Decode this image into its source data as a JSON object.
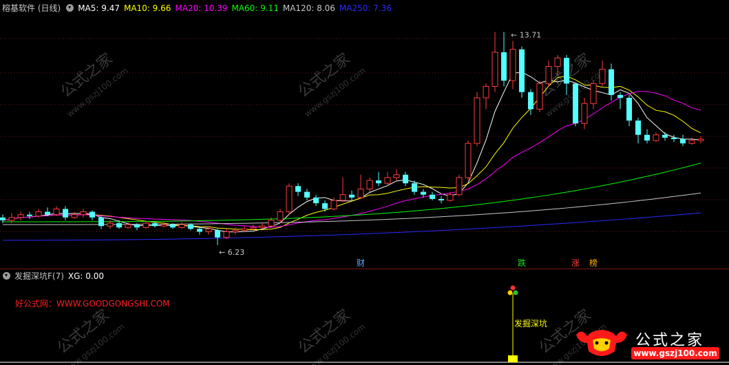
{
  "header": {
    "title": "榕基软件 (日线)",
    "ma": [
      {
        "label": "MA5: 9.47",
        "color": "#ffffff"
      },
      {
        "label": "MA10: 9.66",
        "color": "#ffff00"
      },
      {
        "label": "MA20: 10.39",
        "color": "#ff00ff"
      },
      {
        "label": "MA60: 9.11",
        "color": "#00ff00"
      },
      {
        "label": "MA120: 8.06",
        "color": "#c8c8c8"
      },
      {
        "label": "MA250: 7.36",
        "color": "#0000ff"
      }
    ]
  },
  "indicator": {
    "title": "发掘深坑F(7)",
    "xg": "XG: 0.00",
    "site": "好公式网：WWW.GOODGONGSHI.COM"
  },
  "watermark": {
    "brand": "公式之家",
    "url": "www.gszj100.com",
    "diag_text": "公式之家",
    "diag_url": "www.gszj100.com"
  },
  "chart_data": [
    {
      "type": "candlestick",
      "ylim": [
        5.6,
        14.3
      ],
      "grid": true,
      "annotations": [
        {
          "text": "13.71",
          "kind": "high",
          "bar": 56
        },
        {
          "text": "6.23",
          "kind": "low",
          "bar": 24
        }
      ],
      "event_markers": [
        {
          "text": "财",
          "color": "#5fa8ff",
          "bar": 40
        },
        {
          "text": "跌",
          "color": "#22dd22",
          "bar": 58
        },
        {
          "text": "涨",
          "color": "#ff4040",
          "bar": 64
        },
        {
          "text": "榜",
          "color": "#ffb000",
          "bar": 66
        }
      ],
      "candles": [
        [
          7.2,
          7.1,
          7.3,
          7.0
        ],
        [
          7.1,
          7.2,
          7.35,
          7.0
        ],
        [
          7.2,
          7.3,
          7.4,
          7.1
        ],
        [
          7.3,
          7.25,
          7.4,
          7.15
        ],
        [
          7.25,
          7.4,
          7.5,
          7.2
        ],
        [
          7.4,
          7.3,
          7.55,
          7.25
        ],
        [
          7.3,
          7.5,
          7.6,
          7.25
        ],
        [
          7.5,
          7.2,
          7.6,
          7.1
        ],
        [
          7.2,
          7.3,
          7.4,
          7.15
        ],
        [
          7.3,
          7.4,
          7.5,
          7.2
        ],
        [
          7.4,
          7.2,
          7.45,
          7.1
        ],
        [
          7.2,
          6.9,
          7.25,
          6.8
        ],
        [
          6.9,
          7.0,
          7.1,
          6.8
        ],
        [
          7.0,
          6.85,
          7.1,
          6.8
        ],
        [
          6.85,
          6.95,
          7.05,
          6.8
        ],
        [
          6.95,
          6.85,
          7.0,
          6.75
        ],
        [
          6.85,
          7.0,
          7.1,
          6.8
        ],
        [
          7.0,
          6.9,
          7.05,
          6.85
        ],
        [
          6.9,
          6.95,
          7.05,
          6.85
        ],
        [
          6.95,
          6.85,
          7.0,
          6.8
        ],
        [
          6.85,
          6.95,
          7.05,
          6.8
        ],
        [
          6.95,
          6.8,
          7.0,
          6.75
        ],
        [
          6.8,
          6.7,
          6.85,
          6.6
        ],
        [
          6.7,
          6.8,
          6.9,
          6.6
        ],
        [
          6.75,
          6.5,
          6.8,
          6.23
        ],
        [
          6.5,
          6.7,
          6.8,
          6.45
        ],
        [
          6.7,
          6.75,
          6.85,
          6.6
        ],
        [
          6.75,
          6.8,
          6.9,
          6.7
        ],
        [
          6.8,
          6.85,
          6.95,
          6.75
        ],
        [
          6.85,
          6.9,
          7.0,
          6.8
        ],
        [
          6.9,
          7.1,
          7.2,
          6.85
        ],
        [
          7.1,
          7.4,
          7.5,
          7.0
        ],
        [
          7.4,
          8.3,
          8.4,
          7.3
        ],
        [
          8.3,
          8.1,
          8.4,
          7.95
        ],
        [
          8.1,
          7.9,
          8.2,
          7.8
        ],
        [
          7.9,
          7.7,
          8.0,
          7.6
        ],
        [
          7.7,
          7.5,
          7.8,
          7.4
        ],
        [
          7.5,
          7.8,
          7.9,
          7.45
        ],
        [
          7.8,
          8.0,
          8.6,
          7.75
        ],
        [
          8.0,
          7.9,
          8.15,
          7.8
        ],
        [
          7.9,
          8.2,
          8.7,
          7.85
        ],
        [
          8.2,
          8.5,
          8.6,
          8.1
        ],
        [
          8.5,
          8.4,
          8.8,
          8.3
        ],
        [
          8.4,
          8.6,
          8.8,
          8.3
        ],
        [
          8.6,
          8.7,
          8.9,
          8.5
        ],
        [
          8.7,
          8.4,
          8.8,
          8.3
        ],
        [
          8.4,
          8.1,
          8.5,
          8.0
        ],
        [
          8.1,
          8.0,
          8.2,
          7.9
        ],
        [
          8.0,
          7.85,
          8.1,
          7.8
        ],
        [
          7.85,
          7.8,
          7.95,
          7.7
        ],
        [
          7.8,
          8.0,
          8.1,
          7.75
        ],
        [
          8.0,
          8.6,
          8.7,
          7.95
        ],
        [
          8.6,
          9.8,
          9.9,
          8.5
        ],
        [
          9.8,
          11.4,
          11.6,
          9.7
        ],
        [
          11.4,
          11.8,
          11.9,
          11.0
        ],
        [
          11.8,
          13.0,
          13.71,
          11.6
        ],
        [
          13.0,
          12.0,
          13.71,
          11.8
        ],
        [
          12.0,
          13.1,
          13.4,
          11.7
        ],
        [
          13.1,
          11.6,
          13.2,
          11.4
        ],
        [
          11.6,
          11.0,
          11.7,
          10.8
        ],
        [
          11.0,
          11.9,
          12.0,
          10.9
        ],
        [
          11.9,
          12.5,
          12.7,
          11.8
        ],
        [
          12.5,
          12.8,
          12.9,
          12.2
        ],
        [
          12.8,
          11.9,
          12.9,
          11.5
        ],
        [
          11.9,
          10.5,
          11.2,
          10.4
        ],
        [
          10.5,
          11.2,
          11.4,
          10.3
        ],
        [
          11.2,
          11.9,
          12.0,
          11.0
        ],
        [
          11.9,
          12.4,
          12.7,
          11.8
        ],
        [
          12.4,
          11.5,
          12.6,
          11.3
        ],
        [
          11.5,
          11.4,
          11.6,
          11.0
        ],
        [
          11.4,
          10.6,
          11.5,
          10.4
        ],
        [
          10.6,
          10.1,
          10.7,
          9.8
        ],
        [
          10.1,
          9.9,
          10.3,
          9.8
        ],
        [
          9.9,
          10.1,
          10.2,
          9.85
        ],
        [
          10.1,
          10.0,
          10.2,
          9.9
        ],
        [
          10.0,
          9.95,
          10.1,
          9.85
        ],
        [
          9.95,
          9.8,
          10.1,
          9.7
        ],
        [
          9.8,
          9.9,
          10.0,
          9.75
        ],
        [
          9.9,
          9.95,
          10.05,
          9.8
        ]
      ]
    },
    {
      "type": "bar",
      "name": "XG",
      "signal_label": "发掘深坑",
      "signal_bar": 57,
      "value": 0.0
    }
  ]
}
